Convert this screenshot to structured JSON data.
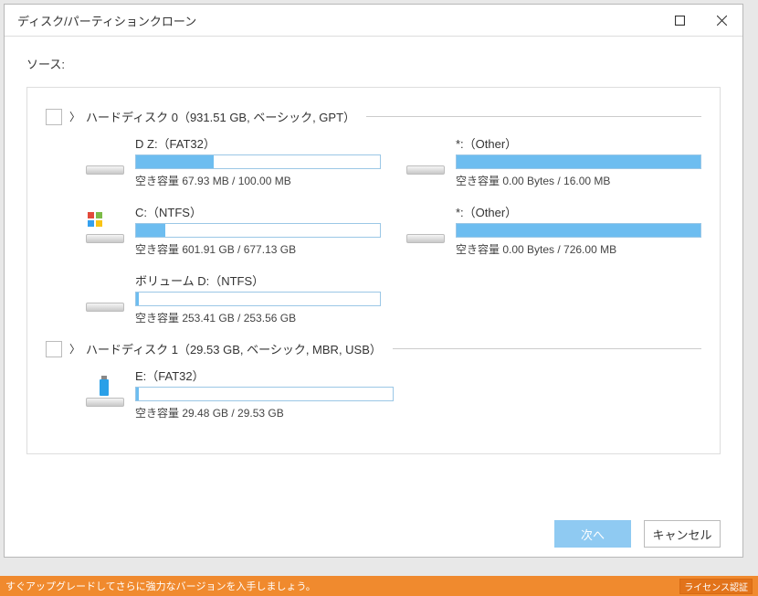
{
  "window": {
    "title": "ディスク/パーティションクローン"
  },
  "source_label": "ソース:",
  "disks": [
    {
      "header": "ハードディスク 0（931.51 GB, ベーシック, GPT）",
      "partitions": [
        {
          "name": "D Z:（FAT32）",
          "free_text": "空き容量 67.93 MB / 100.00 MB",
          "fill_pct": 32
        },
        {
          "name": "*:（Other）",
          "free_text": "空き容量 0.00 Bytes / 16.00 MB",
          "fill_pct": 100
        },
        {
          "name": "C:（NTFS）",
          "free_text": "空き容量 601.91 GB / 677.13 GB",
          "fill_pct": 12,
          "os": true
        },
        {
          "name": "*:（Other）",
          "free_text": "空き容量 0.00 Bytes / 726.00 MB",
          "fill_pct": 100
        },
        {
          "name": "ボリューム D:（NTFS）",
          "free_text": "空き容量 253.41 GB / 253.56 GB",
          "fill_pct": 1
        }
      ]
    },
    {
      "header": "ハードディスク 1（29.53 GB, ベーシック, MBR, USB）",
      "partitions": [
        {
          "name": "E:（FAT32）",
          "free_text": "空き容量 29.48 GB / 29.53 GB",
          "fill_pct": 1,
          "usb": true
        }
      ]
    }
  ],
  "footer": {
    "next": "次へ",
    "cancel": "キャンセル"
  },
  "ribbon": {
    "text": "すぐアップグレードしてさらに強力なバージョンを入手しましょう。",
    "tag": "ライセンス認証"
  }
}
